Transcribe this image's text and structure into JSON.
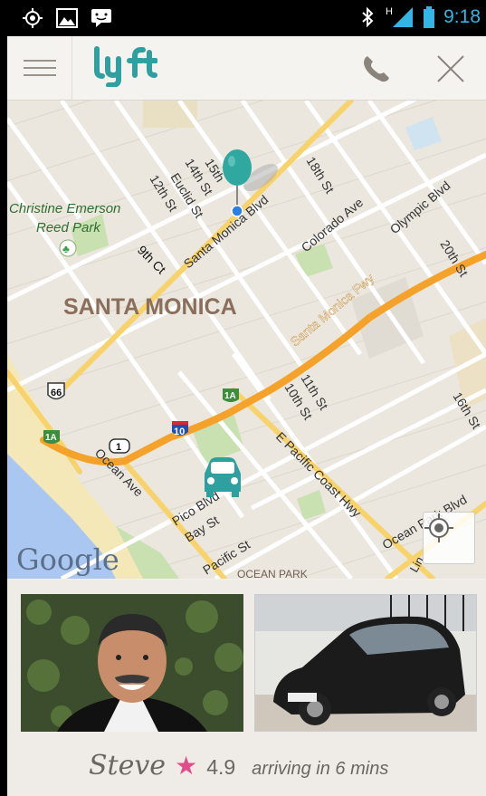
{
  "status_bar": {
    "time": "9:18",
    "network": "H",
    "left_icons": [
      "gps-icon",
      "image-icon",
      "messenger-icon"
    ],
    "right_icons": [
      "bluetooth-icon",
      "signal-icon",
      "battery-icon"
    ]
  },
  "app_bar": {
    "logo": "lyft",
    "brand_color": "#2f9fa0",
    "menu_icon": "hamburger-icon",
    "phone_icon": "phone-icon",
    "close_icon": "close-icon"
  },
  "map": {
    "area_label": "SANTA MONICA",
    "park_label_1": "Christine Emerson",
    "park_label_2": "Reed Park",
    "streets": {
      "fifteenth": "15th",
      "fourteenth": "14th St",
      "euclid": "Euclid St",
      "twelfth": "12th St",
      "ninth": "9th Ct",
      "santa_monica_blvd": "Santa Monica Blvd",
      "eighteenth": "18th St",
      "colorado": "Colorado Ave",
      "olympic": "Olympic Blvd",
      "twentieth": "20th St",
      "santa_monica_fwy": "Santa Monica Fwy",
      "eleventh": "11th St",
      "tenth": "10th St",
      "sixteenth": "16th St",
      "pacific_coast_hwy": "E Pacific Coast Hwy",
      "ocean_park_blvd": "Ocean Park Blvd",
      "ocean_ave": "Ocean Ave",
      "pico": "Pico Blvd",
      "bay": "Bay St",
      "pacific": "Pacific St",
      "ocean_park": "OCEAN PARK",
      "lincoln": "Lin"
    },
    "shields": {
      "us66": "66",
      "i10": "10",
      "ca1": "1",
      "ca1a_a": "1A",
      "ca1a_b": "1A"
    },
    "attribution": "Google",
    "pin_color": "#2fa89f",
    "car_color": "#2f9fa0"
  },
  "driver": {
    "name": "Steve",
    "rating": "4.9",
    "eta_text": "arriving in 6 mins",
    "star_color": "#e04e8a"
  }
}
